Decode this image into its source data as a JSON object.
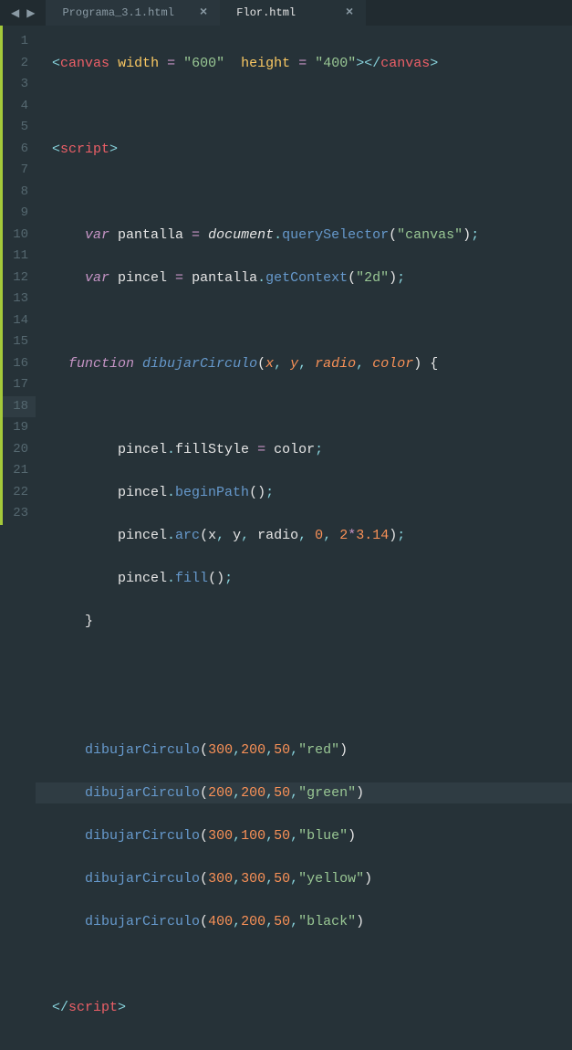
{
  "nav": {
    "back": "◀",
    "forward": "▶"
  },
  "tabs": [
    {
      "label": "Programa_3.1.html",
      "active": false
    },
    {
      "label": "Flor.html",
      "active": true
    }
  ],
  "lines": [
    1,
    2,
    3,
    4,
    5,
    6,
    7,
    8,
    9,
    10,
    11,
    12,
    13,
    14,
    15,
    16,
    17,
    18,
    19,
    20,
    21,
    22,
    23
  ],
  "activeLine": 18,
  "code": {
    "l1": {
      "t1": "<",
      "t2": "canvas",
      "t3": " ",
      "t4": "width",
      "t5": " ",
      "t6": "=",
      "t7": " ",
      "t8": "\"600\"",
      "t9": "  ",
      "t10": "height",
      "t11": " ",
      "t12": "=",
      "t13": " ",
      "t14": "\"400\"",
      "t15": ">",
      "t16": "</",
      "t17": "canvas",
      "t18": ">"
    },
    "l3": {
      "t1": "<",
      "t2": "script",
      "t3": ">"
    },
    "l5": {
      "t1": "var",
      "t2": " pantalla ",
      "t3": "=",
      "t4": " ",
      "t5": "document",
      "t6": ".",
      "t7": "querySelector",
      "t8": "(",
      "t9": "\"canvas\"",
      "t10": ")",
      "t11": ";"
    },
    "l6": {
      "t1": "var",
      "t2": " pincel ",
      "t3": "=",
      "t4": " pantalla",
      "t5": ".",
      "t6": "getContext",
      "t7": "(",
      "t8": "\"2d\"",
      "t9": ")",
      "t10": ";"
    },
    "l8": {
      "t1": "function",
      "t2": " ",
      "t3": "dibujarCirculo",
      "t4": "(",
      "t5": "x",
      "t6": ", ",
      "t7": "y",
      "t8": ", ",
      "t9": "radio",
      "t10": ", ",
      "t11": "color",
      "t12": ")",
      "t13": " {"
    },
    "l10": {
      "t1": "pincel",
      "t2": ".",
      "t3": "fillStyle ",
      "t4": "=",
      "t5": " color",
      "t6": ";"
    },
    "l11": {
      "t1": "pincel",
      "t2": ".",
      "t3": "beginPath",
      "t4": "()",
      "t5": ";"
    },
    "l12": {
      "t1": "pincel",
      "t2": ".",
      "t3": "arc",
      "t4": "(x",
      "t5": ",",
      "t6": " y",
      "t7": ",",
      "t8": " radio",
      "t9": ",",
      "t10": " ",
      "t11": "0",
      "t12": ",",
      "t13": " ",
      "t14": "2",
      "t15": "*",
      "t16": "3.14",
      "t17": ")",
      "t18": ";"
    },
    "l13": {
      "t1": "pincel",
      "t2": ".",
      "t3": "fill",
      "t4": "()",
      "t5": ";"
    },
    "l14": {
      "t1": "}"
    },
    "l17": {
      "t1": "dibujarCirculo",
      "t2": "(",
      "t3": "300",
      "t4": ",",
      "t5": "200",
      "t6": ",",
      "t7": "50",
      "t8": ",",
      "t9": "\"red\"",
      "t10": ")"
    },
    "l18": {
      "t1": "dibujarCirculo",
      "t2": "(",
      "t3": "200",
      "t4": ",",
      "t5": "200",
      "t6": ",",
      "t7": "50",
      "t8": ",",
      "t9": "\"green\"",
      "t10": ")"
    },
    "l19": {
      "t1": "dibujarCirculo",
      "t2": "(",
      "t3": "300",
      "t4": ",",
      "t5": "100",
      "t6": ",",
      "t7": "50",
      "t8": ",",
      "t9": "\"blue\"",
      "t10": ")"
    },
    "l20": {
      "t1": "dibujarCirculo",
      "t2": "(",
      "t3": "300",
      "t4": ",",
      "t5": "300",
      "t6": ",",
      "t7": "50",
      "t8": ",",
      "t9": "\"yellow\"",
      "t10": ")"
    },
    "l21": {
      "t1": "dibujarCirculo",
      "t2": "(",
      "t3": "400",
      "t4": ",",
      "t5": "200",
      "t6": ",",
      "t7": "50",
      "t8": ",",
      "t9": "\"black\"",
      "t10": ")"
    },
    "l23": {
      "t1": "</",
      "t2": "script",
      "t3": ">"
    }
  }
}
